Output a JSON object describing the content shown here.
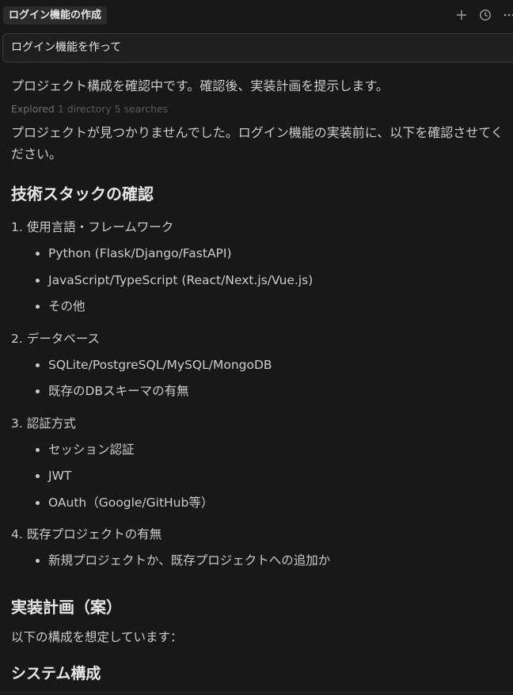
{
  "header": {
    "title": "ログイン機能の作成",
    "icons": [
      "plus-icon",
      "history-icon",
      "more-icon"
    ]
  },
  "prompt": {
    "text": "ログイン機能を作って"
  },
  "response": {
    "intro": "プロジェクト構成を確認中です。確認後、実装計画を提示します。",
    "explored": {
      "label": "Explored",
      "detail": "1 directory 5 searches"
    },
    "paragraph": "プロジェクトが見つかりませんでした。ログイン機能の実装前に、以下を確認させてください。",
    "tech_heading": "技術スタックの確認",
    "sections": [
      {
        "title": "1. 使用言語・フレームワーク",
        "items": [
          "Python (Flask/Django/FastAPI)",
          "JavaScript/TypeScript (React/Next.js/Vue.js)",
          "その他"
        ]
      },
      {
        "title": "2. データベース",
        "items": [
          "SQLite/PostgreSQL/MySQL/MongoDB",
          "既存のDBスキーマの有無"
        ]
      },
      {
        "title": "3. 認証方式",
        "items": [
          "セッション認証",
          "JWT",
          "OAuth（Google/GitHub等）"
        ]
      },
      {
        "title": "4. 既存プロジェクトの有無",
        "items": [
          "新規プロジェクトか、既存プロジェクトへの追加か"
        ]
      }
    ],
    "plan_heading": "実装計画（案）",
    "plan_text": "以下の構成を想定しています：",
    "system_heading": "システム構成"
  }
}
